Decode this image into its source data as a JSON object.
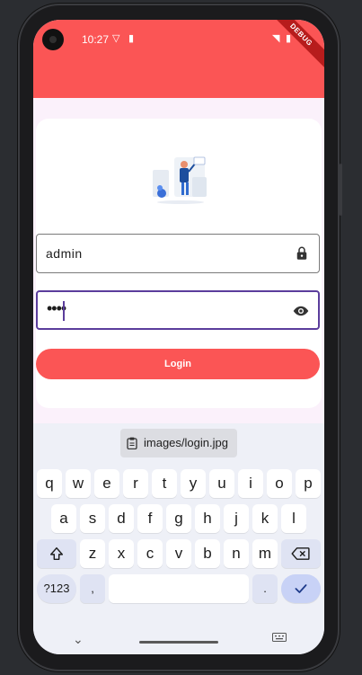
{
  "status_bar": {
    "time": "10:27",
    "debug_banner": "DEBUG"
  },
  "form": {
    "image_alt": "login illustration",
    "username_value": "admin",
    "password_value": "••••",
    "login_label": "Login"
  },
  "keyboard": {
    "clipboard_suggestion": "images/login.jpg",
    "row1": [
      "q",
      "w",
      "e",
      "r",
      "t",
      "y",
      "u",
      "i",
      "o",
      "p"
    ],
    "row2": [
      "a",
      "s",
      "d",
      "f",
      "g",
      "h",
      "j",
      "k",
      "l"
    ],
    "row3": [
      "z",
      "x",
      "c",
      "v",
      "b",
      "n",
      "m"
    ],
    "symbols_label": "?123",
    "comma": ",",
    "period": "."
  },
  "colors": {
    "accent": "#fb5555",
    "focus": "#5b3d9c"
  }
}
